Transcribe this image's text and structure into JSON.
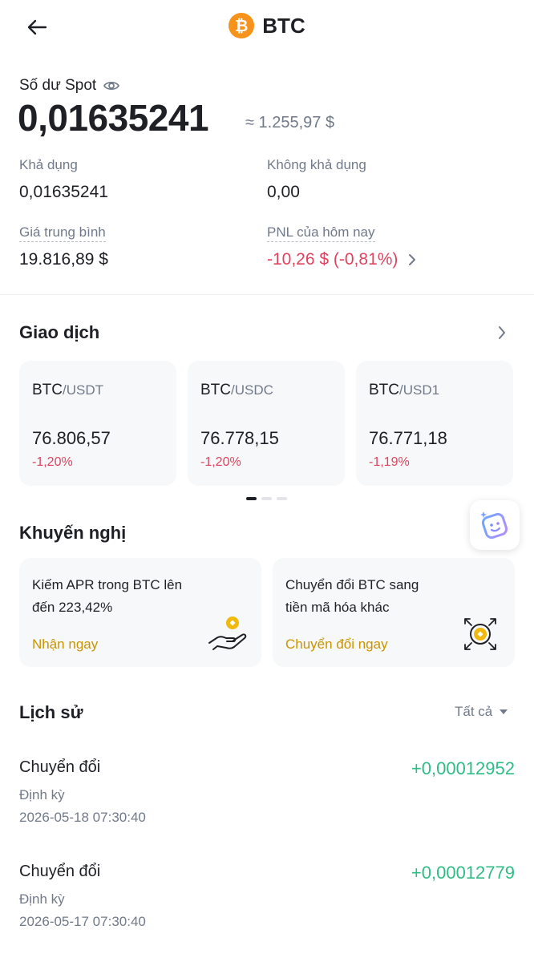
{
  "header": {
    "title": "BTC",
    "coin_symbol": "₿"
  },
  "balance": {
    "label": "Số dư Spot",
    "amount": "0,01635241",
    "usd_approx": "≈ 1.255,97 $"
  },
  "stats": {
    "available_label": "Khả dụng",
    "available_value": "0,01635241",
    "unavailable_label": "Không khả dụng",
    "unavailable_value": "0,00",
    "avg_price_label": "Giá trung bình",
    "avg_price_value": "19.816,89 $",
    "pnl_label": "PNL của hôm nay",
    "pnl_value": "-10,26 $ (-0,81%)"
  },
  "trading": {
    "title": "Giao dịch",
    "pairs": [
      {
        "base": "BTC",
        "quote": "/USDT",
        "price": "76.806,57",
        "change": "-1,20%"
      },
      {
        "base": "BTC",
        "quote": "/USDC",
        "price": "76.778,15",
        "change": "-1,20%"
      },
      {
        "base": "BTC",
        "quote": "/USD1",
        "price": "76.771,18",
        "change": "-1,19%"
      }
    ]
  },
  "recommend": {
    "title": "Khuyến nghị",
    "cards": [
      {
        "line1": "Kiếm APR trong BTC lên",
        "line2": "đến 223,42%",
        "cta": "Nhận ngay"
      },
      {
        "line1": "Chuyển đổi BTC sang",
        "line2": "tiền mã hóa khác",
        "cta": "Chuyển đổi ngay"
      }
    ]
  },
  "history": {
    "title": "Lịch sử",
    "filter": "Tất cả",
    "items": [
      {
        "type": "Chuyển đổi",
        "sub": "Định kỳ",
        "time": "2026-05-18 07:30:40",
        "amount": "+0,00012952"
      },
      {
        "type": "Chuyển đổi",
        "sub": "Định kỳ",
        "time": "2026-05-17 07:30:40",
        "amount": "+0,00012779"
      }
    ]
  },
  "colors": {
    "accent_gold": "#c99400",
    "btc_orange": "#f7931a",
    "up_green": "#2ebd85",
    "down_red": "#e0435f"
  }
}
